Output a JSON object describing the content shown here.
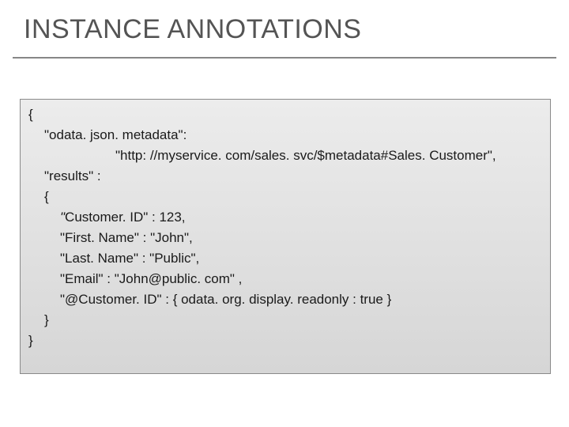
{
  "title": "INSTANCE ANNOTATIONS",
  "code": {
    "l1": "{",
    "l2": "\"odata. json. metadata\":",
    "l3": "\"http: //myservice. com/sales. svc/$metadata#Sales. Customer\",",
    "l4": "\"results\" :",
    "l5": "{",
    "l6_a": "\"",
    "l6_b": "Customer. ID\" : 123,",
    "l7": "\"First. Name\" : \"John\",",
    "l8": "\"Last. Name\" : \"Public\",",
    "l9": "\"Email\" : \"John@public. com\" ,",
    "l10": "\"@Customer. ID\" : { odata. org. display. readonly : true }",
    "l11": "}",
    "l12": "}"
  }
}
